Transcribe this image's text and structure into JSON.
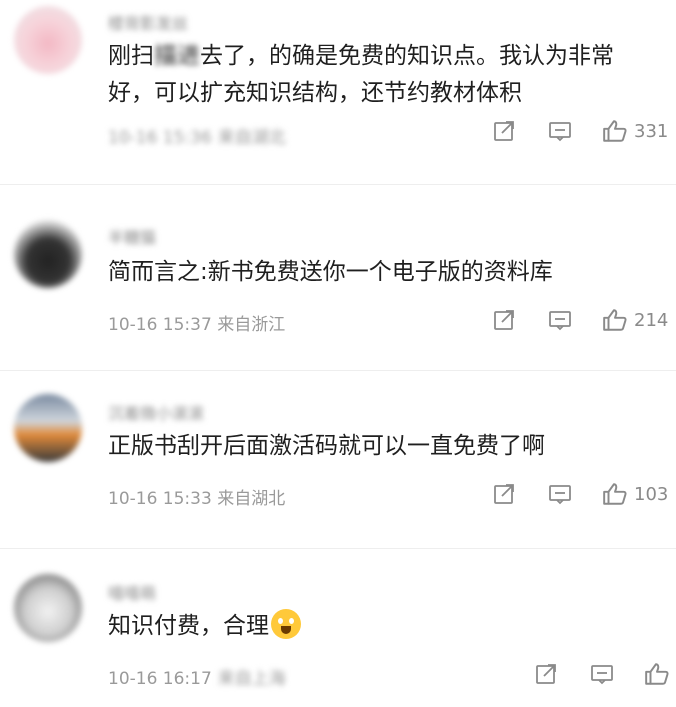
{
  "comments": [
    {
      "name": "楼背影发丝",
      "text_a": "刚扫",
      "text_redacted": "描进",
      "text_b": "去了，的确是免费的知识点。我认为非常好，可以扩充知识结构，还节约教材体积",
      "meta_date": "10-16 15:36",
      "meta_location": "来自湖北",
      "likes": "331"
    },
    {
      "name": "半糖猫",
      "text": "简而言之:新书免费送你一个电子版的资料库",
      "meta_date": "10-16 15:37",
      "meta_location": "来自浙江",
      "likes": "214"
    },
    {
      "name": "沉着微小滚滚",
      "text": "正版书刮开后面激活码就可以一直免费了啊",
      "meta_date": "10-16 15:33",
      "meta_location": "来自湖北",
      "likes": "103"
    },
    {
      "name": "嘻嘻萌",
      "text": "知识付费，合理",
      "emoji": "screaming-face-emoji",
      "meta_date": "10-16 16:17",
      "meta_location": "来自上海",
      "likes": ""
    }
  ],
  "icons": {
    "share": "share-icon",
    "reply": "comment-icon",
    "like": "thumbs-up-icon"
  },
  "colors": {
    "text": "#1f1f1f",
    "meta": "#9a9a9a",
    "icon": "#8a8a8a"
  }
}
